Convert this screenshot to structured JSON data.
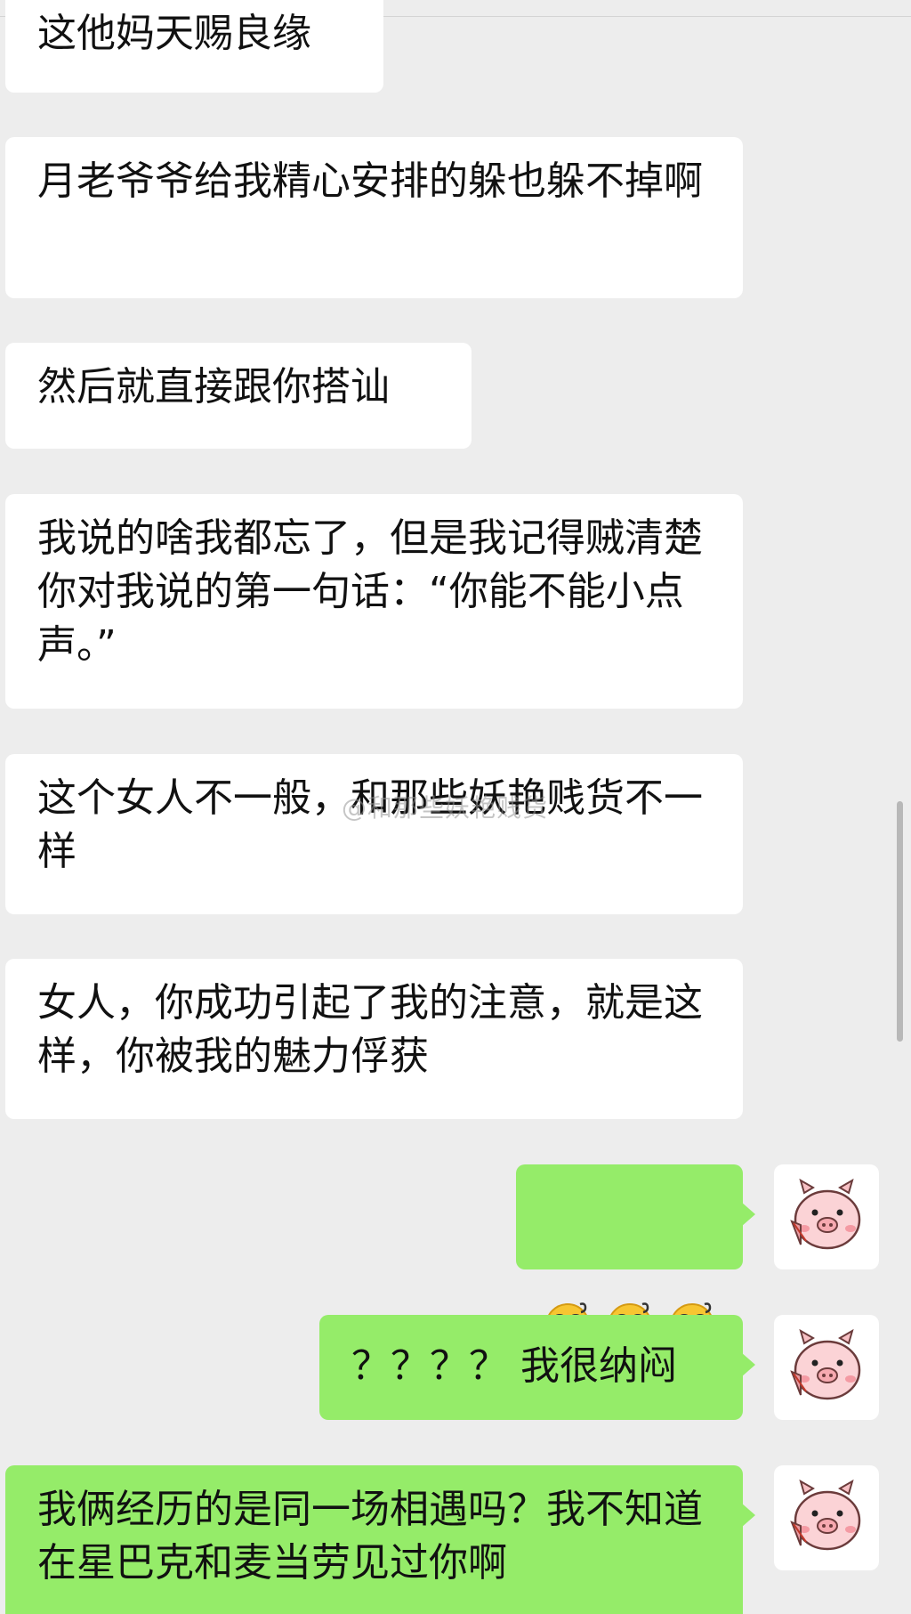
{
  "chat": {
    "messages": [
      {
        "side": "left",
        "text": "这他妈天赐良缘"
      },
      {
        "side": "left",
        "text": "月老爷爷给我精心安排的躲也躲不掉啊"
      },
      {
        "side": "left",
        "text": "然后就直接跟你搭讪"
      },
      {
        "side": "left",
        "text": "我说的啥我都忘了，但是我记得贼清楚你对我说的第一句话：“你能不能小点声。”"
      },
      {
        "side": "left",
        "text": "这个女人不一般，和那些妖艳贱货不一样"
      },
      {
        "side": "left",
        "text": "女人，你成功引起了我的注意，就是这样，你被我的魅力俘获"
      },
      {
        "side": "right",
        "emoji_icon": "dizzy-face-emoji",
        "emoji_count": 3
      },
      {
        "side": "right",
        "text": "？？？？ 我很纳闷"
      },
      {
        "side": "right",
        "text": "我俩经历的是同一场相遇吗？我不知道在星巴克和麦当劳见过你啊"
      }
    ],
    "watermark": "@和那些妖艳贱货",
    "avatar_icon": "pig-face-icon",
    "colors": {
      "background": "#ededed",
      "received_bubble": "#ffffff",
      "sent_bubble": "#95ec69"
    }
  }
}
